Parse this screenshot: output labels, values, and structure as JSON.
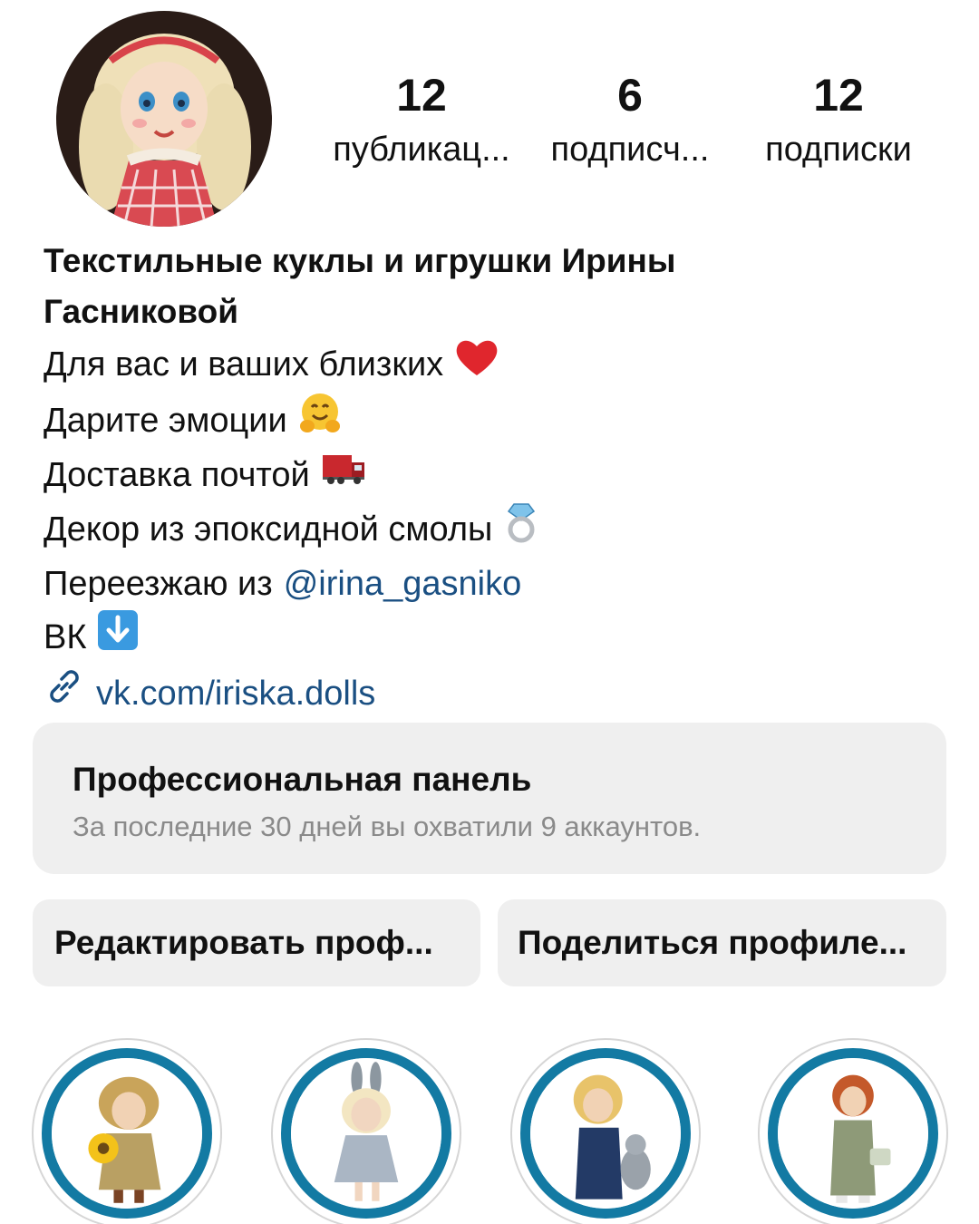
{
  "profile": {
    "avatar_alt": "textile doll avatar"
  },
  "stats": [
    {
      "count": "12",
      "label": "публикац..."
    },
    {
      "count": "6",
      "label": "подписч..."
    },
    {
      "count": "12",
      "label": "подписки"
    }
  ],
  "bio": {
    "name": "Текстильные куклы и игрушки Ирины Гасниковой",
    "lines": [
      {
        "text": "Для вас и ваших близких",
        "emoji": "heart"
      },
      {
        "text": "Дарите эмоции",
        "emoji": "hugging-face"
      },
      {
        "text": "Доставка почтой",
        "emoji": "truck"
      },
      {
        "text": "Декор из эпоксидной смолы",
        "emoji": "ring"
      }
    ],
    "moving_text": "Переезжаю из",
    "mention": "@irina_gasniko",
    "vk_text": "ВК",
    "link": "vk.com/iriska.dolls"
  },
  "pro_panel": {
    "title": "Профессиональная панель",
    "subtitle": "За последние 30 дней вы охватили 9 аккаунтов."
  },
  "buttons": {
    "edit": "Редактировать проф...",
    "share": "Поделиться профиле..."
  },
  "colors": {
    "link": "#1a4f82",
    "highlight_ring": "#137aa3",
    "panel_bg": "#efefef",
    "muted_text": "#8a8a8a"
  }
}
